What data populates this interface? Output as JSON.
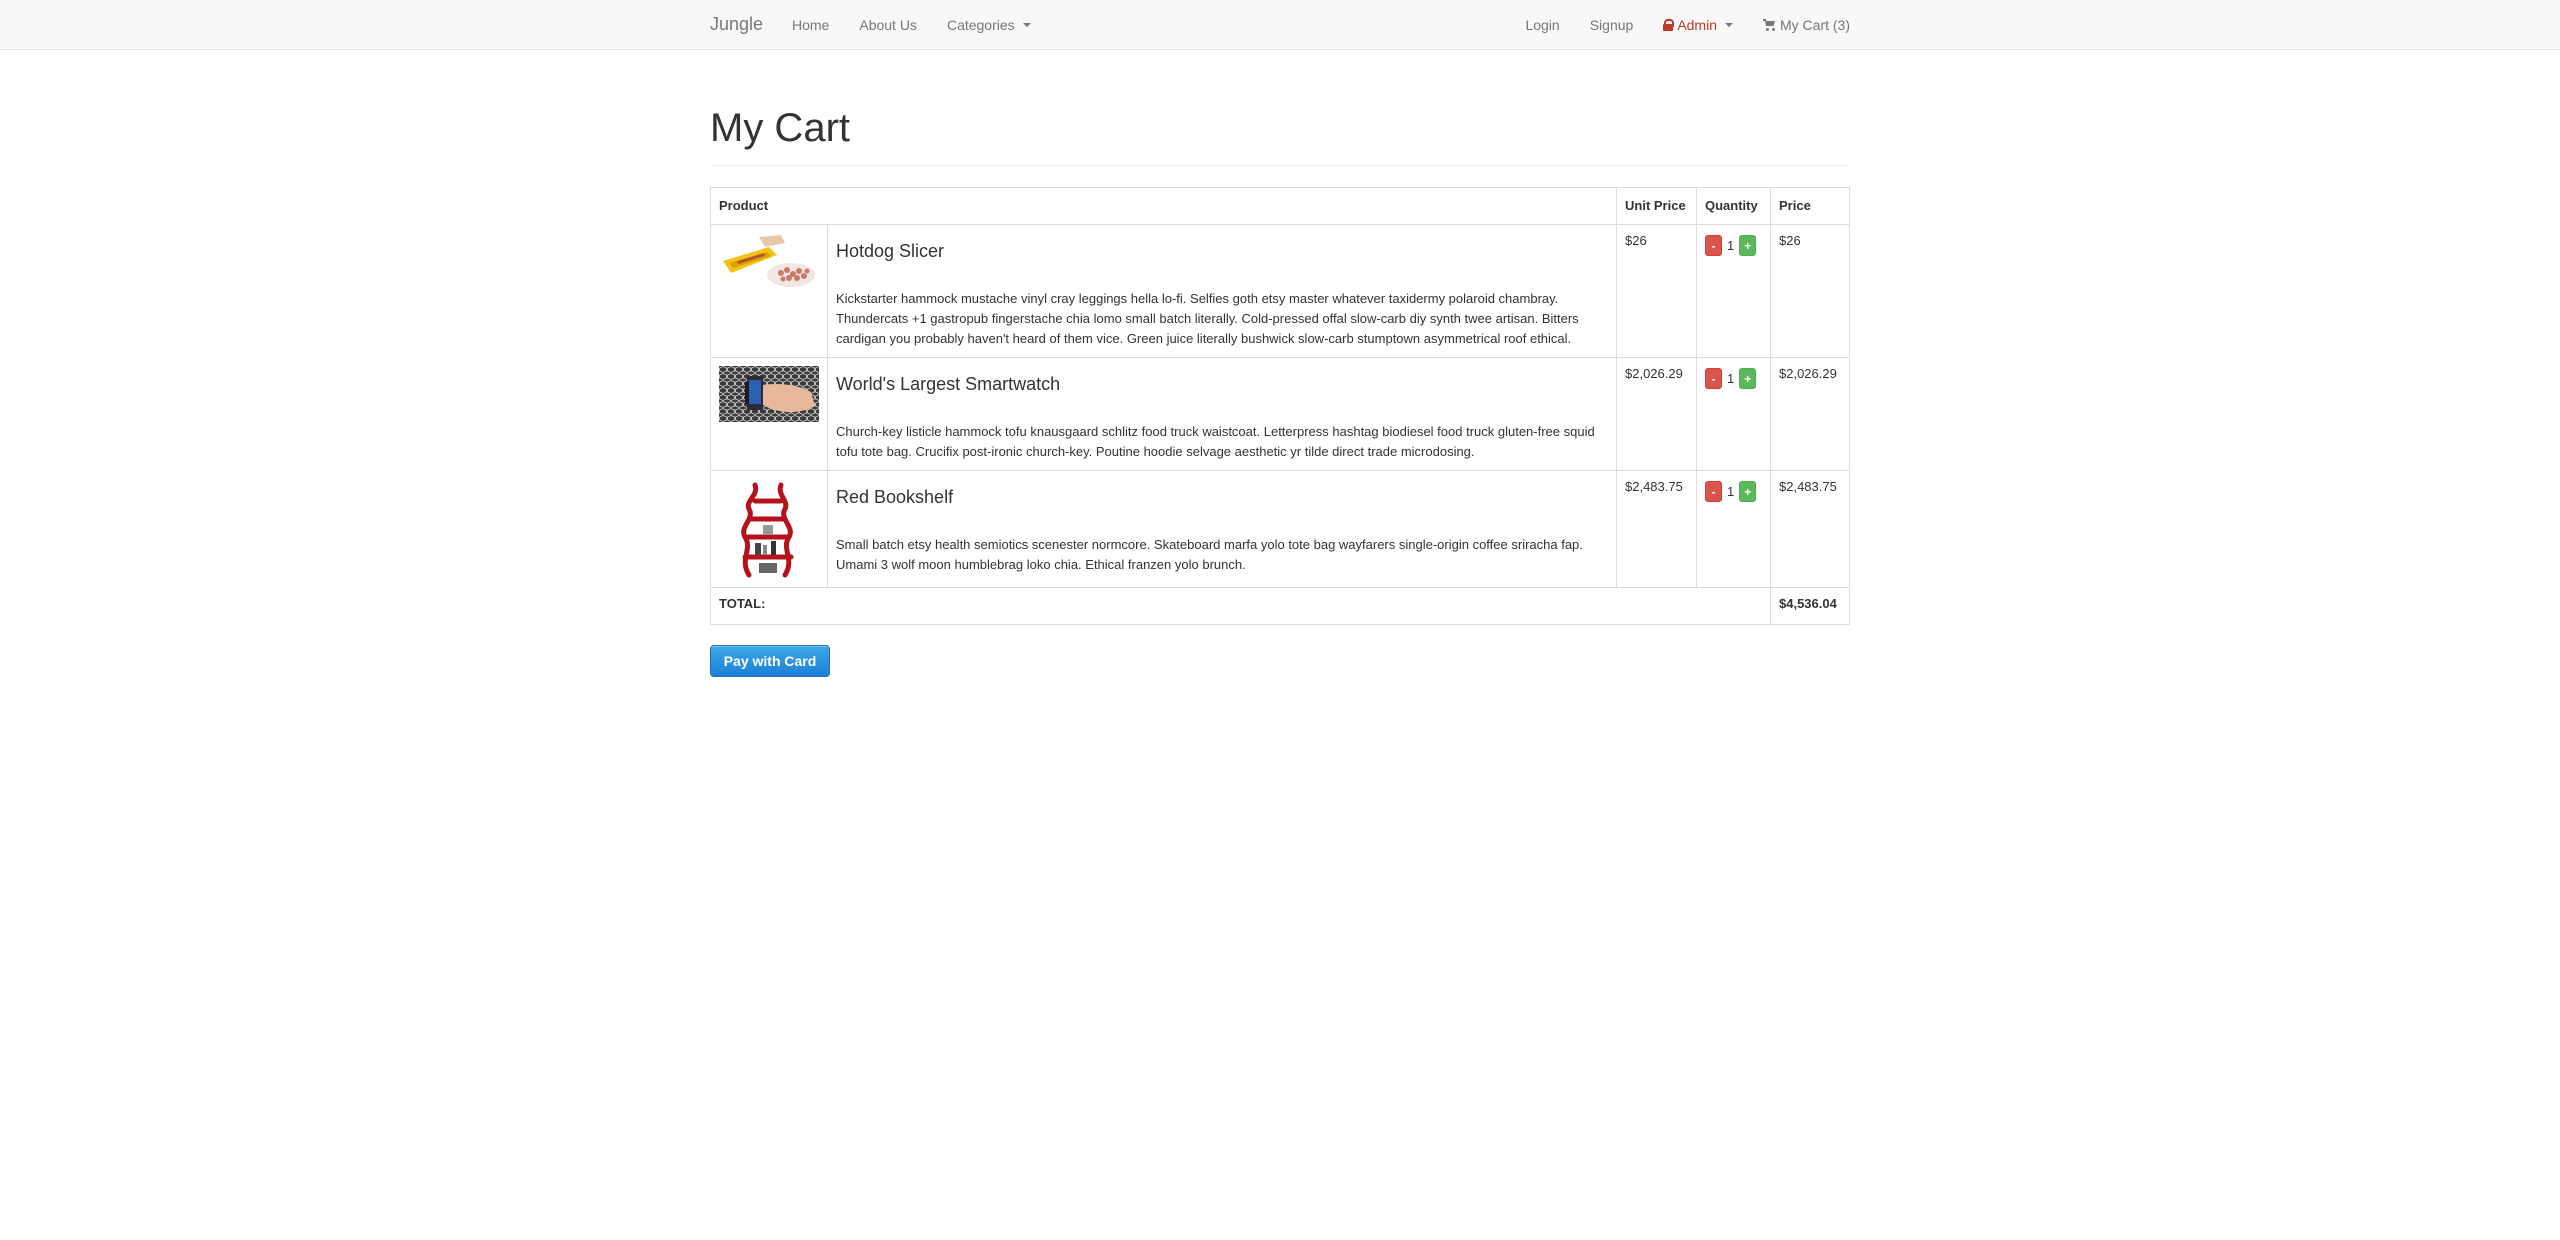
{
  "nav": {
    "brand": "Jungle",
    "left": [
      "Home",
      "About Us",
      "Categories"
    ],
    "right": {
      "login": "Login",
      "signup": "Signup",
      "admin": "Admin",
      "cart": "My Cart (3)"
    }
  },
  "page": {
    "title": "My Cart"
  },
  "table": {
    "headers": {
      "product": "Product",
      "unit_price": "Unit Price",
      "quantity": "Quantity",
      "price": "Price"
    },
    "rows": [
      {
        "name": "Hotdog Slicer",
        "description": "Kickstarter hammock mustache vinyl cray leggings hella lo-fi. Selfies goth etsy master whatever taxidermy polaroid chambray. Thundercats +1 gastropub fingerstache chia lomo small batch literally. Cold-pressed offal slow-carb diy synth twee artisan. Bitters cardigan you probably haven't heard of them vice. Green juice literally bushwick slow-carb stumptown asymmetrical roof ethical.",
        "unit_price": "$26",
        "qty": "1",
        "price": "$26",
        "minus": "-",
        "plus": "+"
      },
      {
        "name": "World's Largest Smartwatch",
        "description": "Church-key listicle hammock tofu knausgaard schlitz food truck waistcoat. Letterpress hashtag biodiesel food truck gluten-free squid tofu tote bag. Crucifix post-ironic church-key. Poutine hoodie selvage aesthetic yr tilde direct trade microdosing.",
        "unit_price": "$2,026.29",
        "qty": "1",
        "price": "$2,026.29",
        "minus": "-",
        "plus": "+"
      },
      {
        "name": "Red Bookshelf",
        "description": "Small batch etsy health semiotics scenester normcore. Skateboard marfa yolo tote bag wayfarers single-origin coffee sriracha fap. Umami 3 wolf moon humblebrag loko chia. Ethical franzen yolo brunch.",
        "unit_price": "$2,483.75",
        "qty": "1",
        "price": "$2,483.75",
        "minus": "-",
        "plus": "+"
      }
    ],
    "total_label": "TOTAL:",
    "total_value": "$4,536.04"
  },
  "pay_button": "Pay with Card",
  "colors": {
    "minus": "#d9534f",
    "plus": "#5cb85c",
    "admin": "#c0392b",
    "pay": "#1a80d8"
  }
}
